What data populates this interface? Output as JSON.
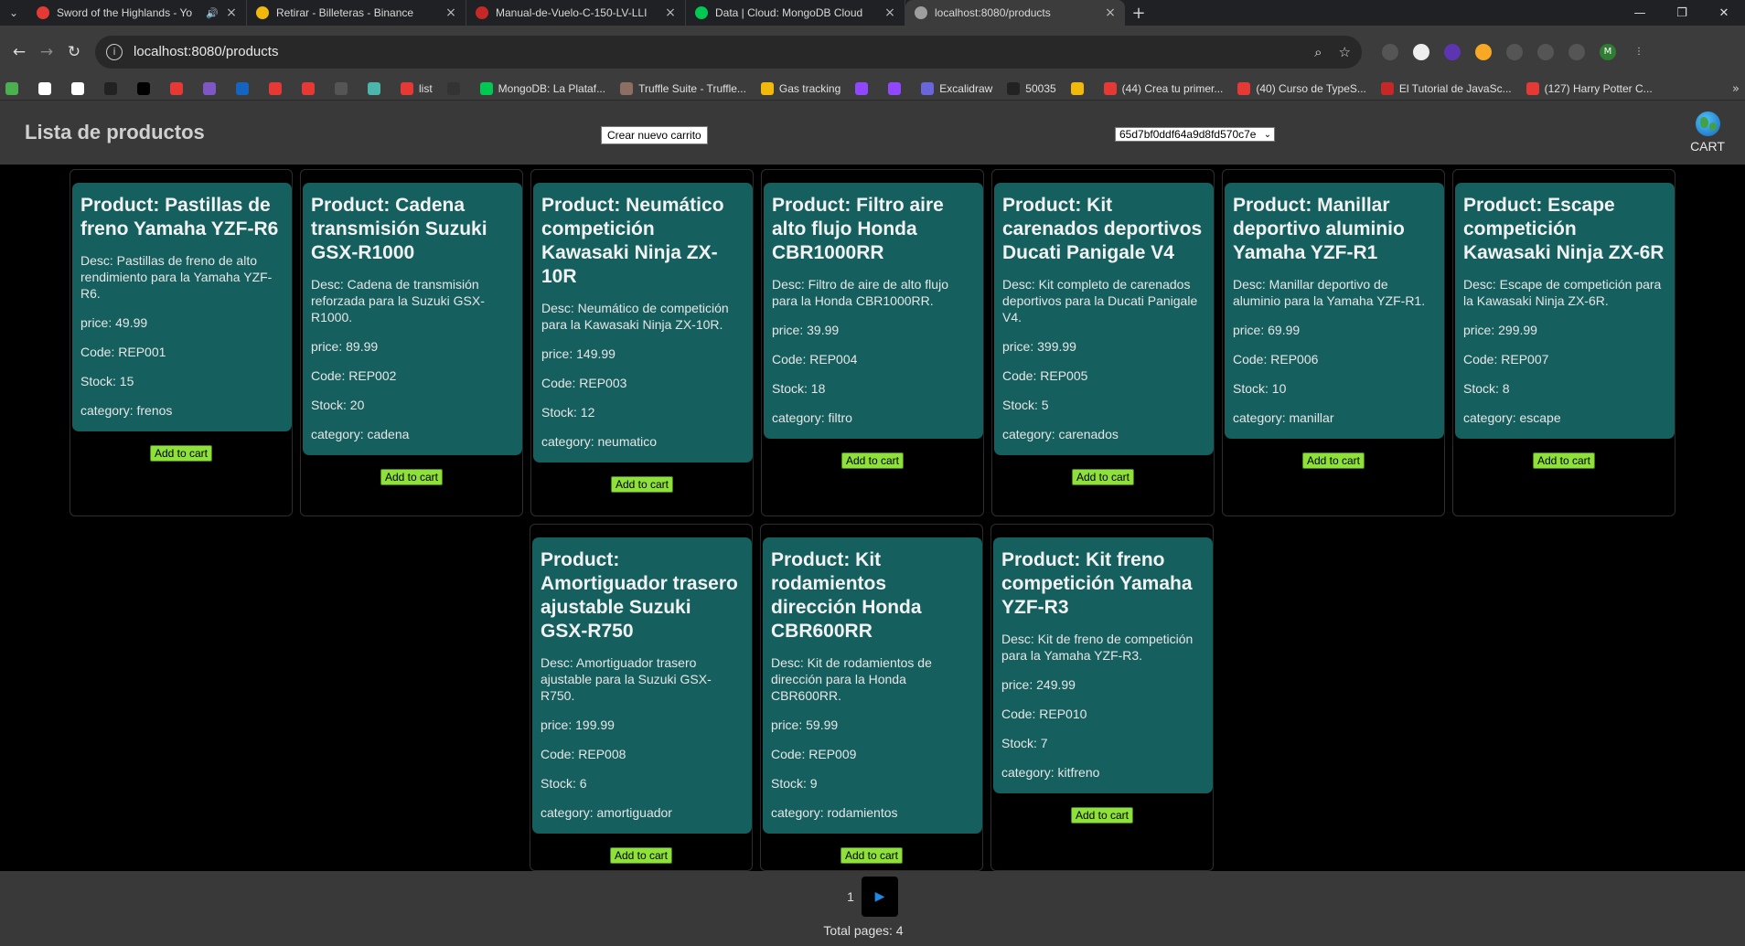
{
  "browser": {
    "tabs": [
      {
        "label": "Sword of the Highlands - Yo",
        "icon_color": "#e53935",
        "audio": true,
        "active": false
      },
      {
        "label": "Retirar - Billeteras - Binance",
        "icon_color": "#f0b90b",
        "audio": false,
        "active": false
      },
      {
        "label": "Manual-de-Vuelo-C-150-LV-LLI",
        "icon_color": "#c62828",
        "audio": false,
        "active": false
      },
      {
        "label": "Data | Cloud: MongoDB Cloud",
        "icon_color": "#00c853",
        "audio": false,
        "active": false
      },
      {
        "label": "localhost:8080/products",
        "icon_color": "#9e9e9e",
        "audio": false,
        "active": true
      }
    ],
    "url": "localhost:8080/products",
    "bookmarks": [
      {
        "label": "",
        "color": "#4caf50"
      },
      {
        "label": "",
        "color": "#ffffff"
      },
      {
        "label": "",
        "color": "#ffffff"
      },
      {
        "label": "",
        "color": "#222222"
      },
      {
        "label": "",
        "color": "#000000"
      },
      {
        "label": "",
        "color": "#e53935"
      },
      {
        "label": "",
        "color": "#7e57c2"
      },
      {
        "label": "",
        "color": "#1565c0"
      },
      {
        "label": "",
        "color": "#e53935"
      },
      {
        "label": "",
        "color": "#e53935"
      },
      {
        "label": "",
        "color": "#555555"
      },
      {
        "label": "",
        "color": "#4db6ac"
      },
      {
        "label": "list",
        "color": "#e53935"
      },
      {
        "label": "",
        "color": "#333333"
      },
      {
        "label": "MongoDB: La Plataf...",
        "color": "#00c853"
      },
      {
        "label": "Truffle Suite - Truffle...",
        "color": "#8d6e63"
      },
      {
        "label": "Gas tracking",
        "color": "#f0b90b"
      },
      {
        "label": "",
        "color": "#9146ff"
      },
      {
        "label": "",
        "color": "#9146ff"
      },
      {
        "label": "Excalidraw",
        "color": "#6965db"
      },
      {
        "label": "50035",
        "color": "#222222"
      },
      {
        "label": "",
        "color": "#f0b90b"
      },
      {
        "label": "(44) Crea tu primer...",
        "color": "#e53935"
      },
      {
        "label": "(40) Curso de TypeS...",
        "color": "#e53935"
      },
      {
        "label": "El Tutorial de JavaSc...",
        "color": "#c62828"
      },
      {
        "label": "(127) Harry Potter C...",
        "color": "#e53935"
      }
    ]
  },
  "page": {
    "title": "Lista de productos",
    "new_cart_button": "Crear nuevo carrito",
    "cart_select_value": "65d7bf0ddf64a9d8fd570c7e",
    "cart_label": "CART"
  },
  "products": [
    {
      "title": "Product: Pastillas de freno Yamaha YZF-R6",
      "desc": "Desc: Pastillas de freno de alto rendimiento para la Yamaha YZF-R6.",
      "price": "price: 49.99",
      "code": "Code: REP001",
      "stock": "Stock: 15",
      "category": "category: frenos"
    },
    {
      "title": "Product: Cadena transmisión Suzuki GSX-R1000",
      "desc": "Desc: Cadena de transmisión reforzada para la Suzuki GSX-R1000.",
      "price": "price: 89.99",
      "code": "Code: REP002",
      "stock": "Stock: 20",
      "category": "category: cadena"
    },
    {
      "title": "Product: Neumático competición Kawasaki Ninja ZX-10R",
      "desc": "Desc: Neumático de competición para la Kawasaki Ninja ZX-10R.",
      "price": "price: 149.99",
      "code": "Code: REP003",
      "stock": "Stock: 12",
      "category": "category: neumatico"
    },
    {
      "title": "Product: Filtro aire alto flujo Honda CBR1000RR",
      "desc": "Desc: Filtro de aire de alto flujo para la Honda CBR1000RR.",
      "price": "price: 39.99",
      "code": "Code: REP004",
      "stock": "Stock: 18",
      "category": "category: filtro"
    },
    {
      "title": "Product: Kit carenados deportivos Ducati Panigale V4",
      "desc": "Desc: Kit completo de carenados deportivos para la Ducati Panigale V4.",
      "price": "price: 399.99",
      "code": "Code: REP005",
      "stock": "Stock: 5",
      "category": "category: carenados"
    },
    {
      "title": "Product: Manillar deportivo aluminio Yamaha YZF-R1",
      "desc": "Desc: Manillar deportivo de aluminio para la Yamaha YZF-R1.",
      "price": "price: 69.99",
      "code": "Code: REP006",
      "stock": "Stock: 10",
      "category": "category: manillar"
    },
    {
      "title": "Product: Escape competición Kawasaki Ninja ZX-6R",
      "desc": "Desc: Escape de competición para la Kawasaki Ninja ZX-6R.",
      "price": "price: 299.99",
      "code": "Code: REP007",
      "stock": "Stock: 8",
      "category": "category: escape"
    },
    {
      "title": "Product: Amortiguador trasero ajustable Suzuki GSX-R750",
      "desc": "Desc: Amortiguador trasero ajustable para la Suzuki GSX-R750.",
      "price": "price: 199.99",
      "code": "Code: REP008",
      "stock": "Stock: 6",
      "category": "category: amortiguador"
    },
    {
      "title": "Product: Kit rodamientos dirección Honda CBR600RR",
      "desc": "Desc: Kit de rodamientos de dirección para la Honda CBR600RR.",
      "price": "price: 59.99",
      "code": "Code: REP009",
      "stock": "Stock: 9",
      "category": "category: rodamientos"
    },
    {
      "title": "Product: Kit freno competición Yamaha YZF-R3",
      "desc": "Desc: Kit de freno de competición para la Yamaha YZF-R3.",
      "price": "price: 249.99",
      "code": "Code: REP010",
      "stock": "Stock: 7",
      "category": "category: kitfreno"
    }
  ],
  "add_to_cart_label": "Add to cart",
  "pagination": {
    "current_page": "1",
    "next_symbol": "▶",
    "total_pages": "Total pages: 4"
  },
  "colors": {
    "card_bg": "#155f5e",
    "add_button": "#8ee03a",
    "header_bg": "#393939",
    "page_bg": "#000000"
  }
}
